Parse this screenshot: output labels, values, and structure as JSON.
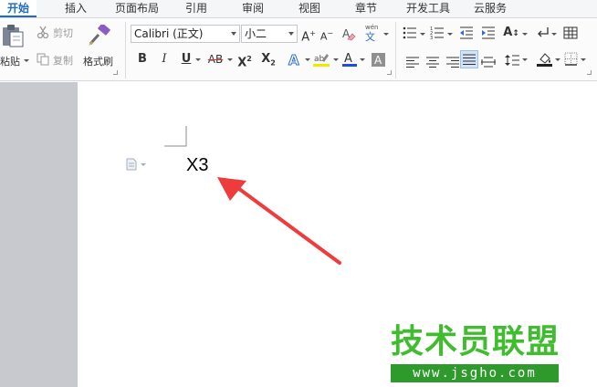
{
  "tabs": [
    {
      "label": "开始",
      "active": true
    },
    {
      "label": "插入"
    },
    {
      "label": "页面布局"
    },
    {
      "label": "引用"
    },
    {
      "label": "审阅"
    },
    {
      "label": "视图"
    },
    {
      "label": "章节"
    },
    {
      "label": "开发工具"
    },
    {
      "label": "云服务"
    }
  ],
  "clipboard": {
    "paste": "粘贴",
    "cut": "剪切",
    "copy": "复制",
    "format_painter": "格式刷"
  },
  "font": {
    "name": "Calibri (正文)",
    "size": "小二",
    "pinyin": "wén"
  },
  "document": {
    "text": "X3"
  },
  "watermark": {
    "title": "技术员联盟",
    "url": "www.jsgho.com"
  },
  "colors": {
    "accent": "#1d6bc9",
    "arrow": "#ee3b3b",
    "watermark_green": "#3fbd2f",
    "watermark_band": "#2e9a2c"
  }
}
